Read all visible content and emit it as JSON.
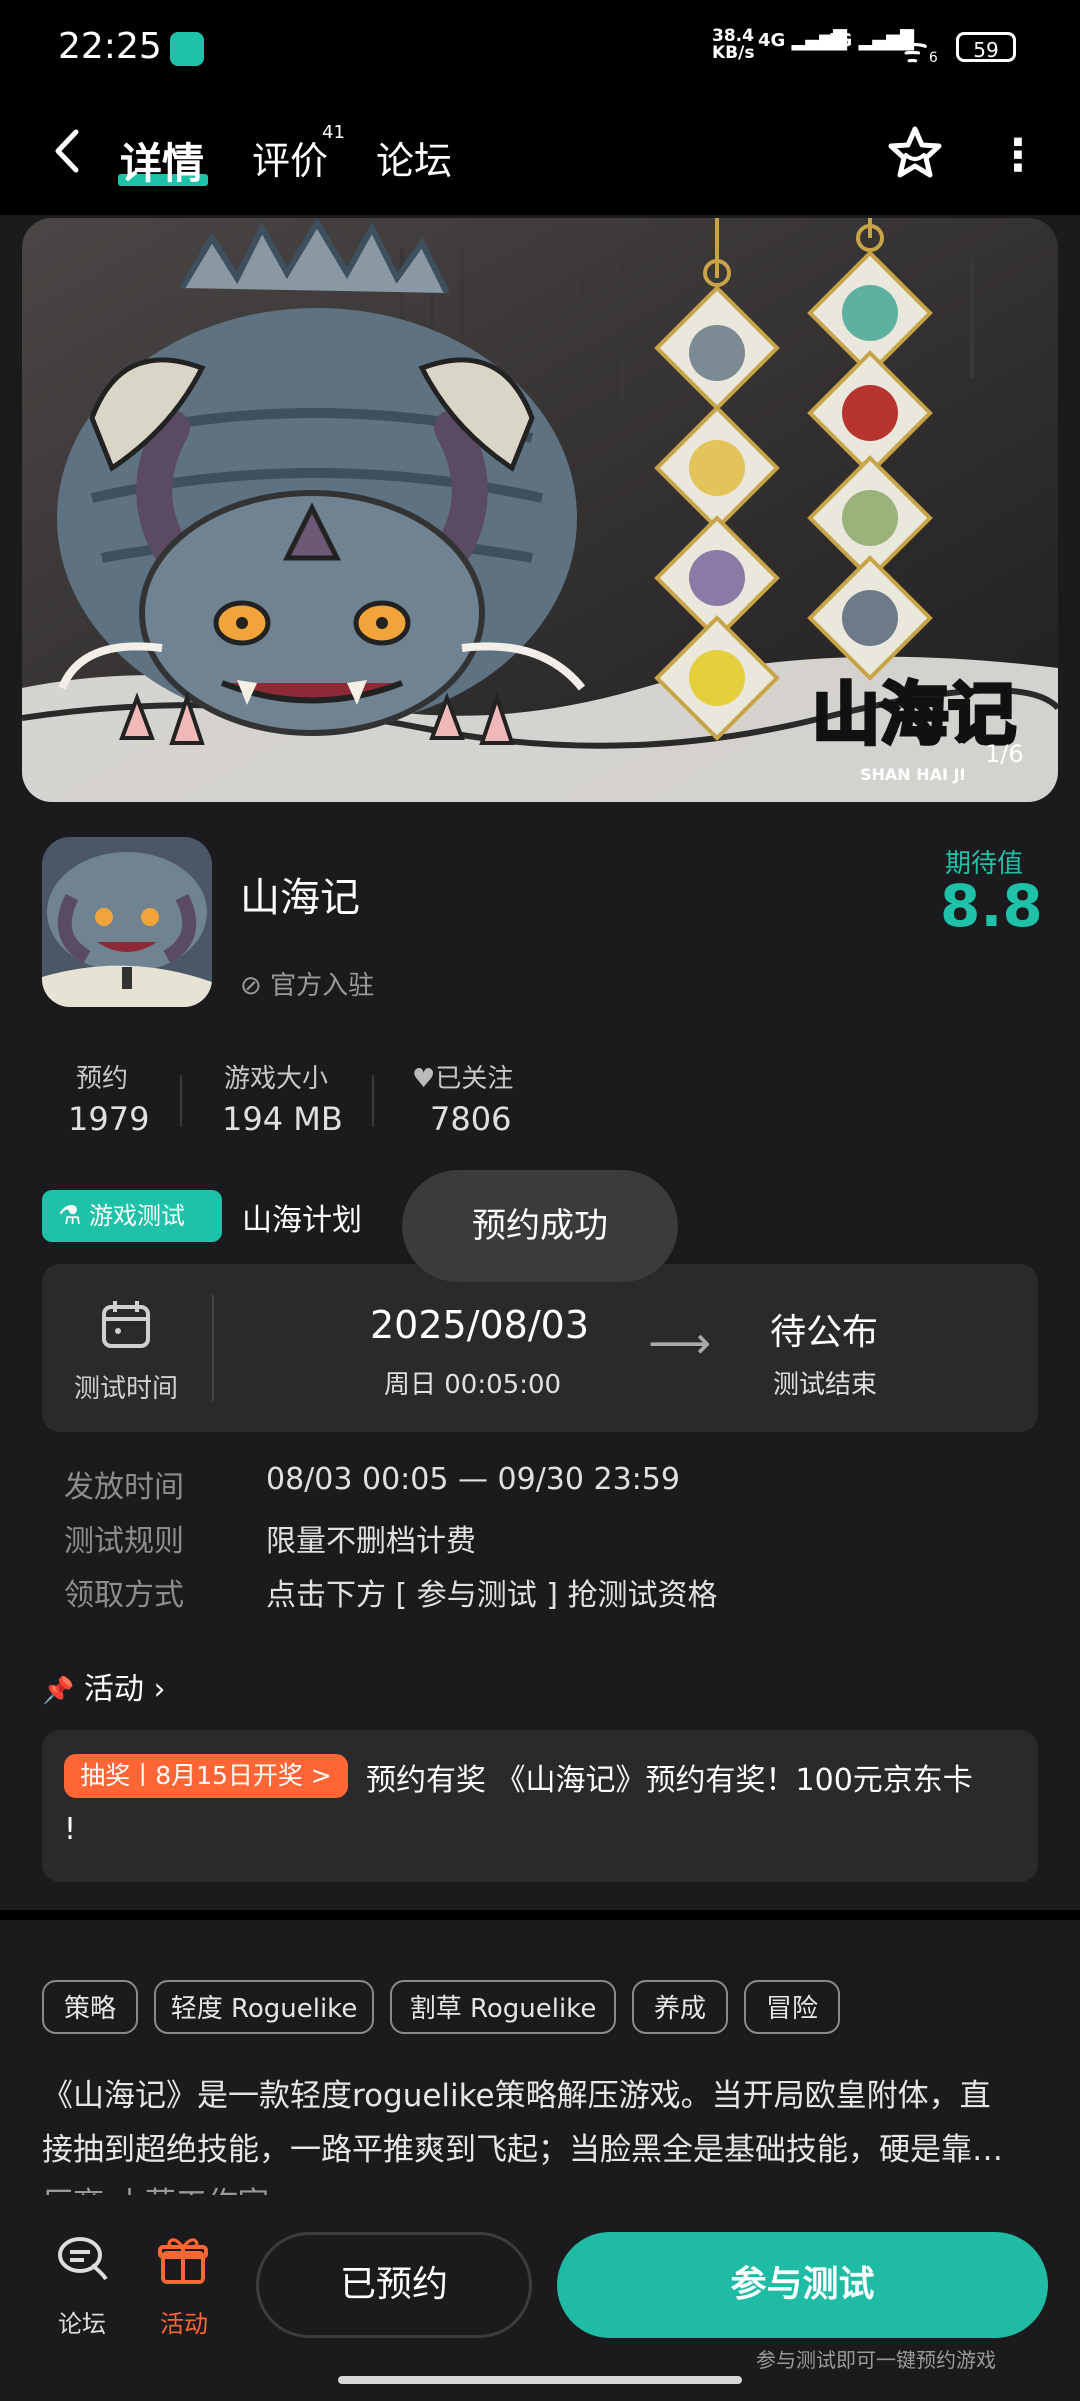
{
  "status_bar": {
    "time": "22:25",
    "net_speed_top": "38.4",
    "net_speed_bottom": "KB/s",
    "sig1": "4G",
    "sig2": "4G",
    "wifi": "6",
    "battery": "59"
  },
  "nav": {
    "back_icon": "chevron-left",
    "tabs": [
      {
        "label": "详情"
      },
      {
        "label": "评价",
        "sup": "41"
      },
      {
        "label": "论坛"
      }
    ],
    "favorite_icon": "star-outline",
    "more_icon": "vertical-dots"
  },
  "banner": {
    "logo_text": "山海记",
    "logo_sub": "SHAN HAI JI",
    "counter": "1/6"
  },
  "game": {
    "title": "山海记",
    "official": "官方入驻",
    "expectation_label": "期待值",
    "expectation_score": "8.8",
    "stats": [
      {
        "label": "预约",
        "value": "1979"
      },
      {
        "label": "游戏大小",
        "value": "194 MB"
      },
      {
        "label": "已关注",
        "value": "7806"
      }
    ]
  },
  "test": {
    "badge": "游戏测试",
    "plan": "山海计划",
    "toast": "预约成功",
    "time_label": "测试时间",
    "start_date": "2025/08/03",
    "start_time": "周日  00:05:00",
    "end_status": "待公布",
    "end_label": "测试结束",
    "info": [
      {
        "label": "发放时间",
        "value": "08/03 00:05 — 09/30 23:59"
      },
      {
        "label": "测试规则",
        "value": "限量不删档计费"
      },
      {
        "label": "领取方式",
        "value": "点击下方 [ 参与测试 ] 抢测试资格"
      }
    ]
  },
  "activity": {
    "heading": "活动",
    "badge": "抽奖丨8月15日开奖 >",
    "text_line1": "预约有奖 《山海记》预约有奖！100元京东卡",
    "text_line2": "!"
  },
  "tags": [
    "策略",
    "轻度 Roguelike",
    "割草 Roguelike",
    "养成",
    "冒险"
  ],
  "description": {
    "line1": "《山海记》是一款轻度roguelike策略解压游戏。当开局欧皇附体，直",
    "line2": "接抽到超绝技能，一路平推爽到飞起；当脸黑全是基础技能，硬是靠…",
    "line3": "厂商  小草工作室 >"
  },
  "bottom": {
    "forum_label": "论坛",
    "activity_label": "活动",
    "reserved_btn": "已预约",
    "join_btn": "参与测试",
    "hint": "参与测试即可一键预约游戏"
  },
  "colors": {
    "accent": "#1fc1a8",
    "orange": "#ff6535",
    "background": "#1b1b1d",
    "card": "#2a2a2c"
  }
}
